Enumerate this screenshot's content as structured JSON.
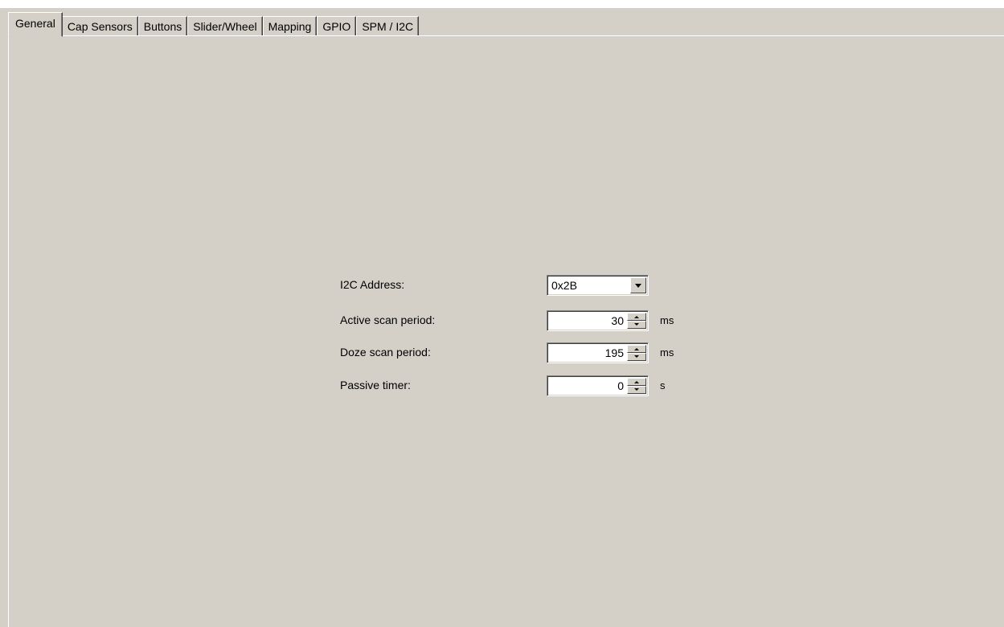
{
  "tabs": [
    {
      "label": "General",
      "active": true
    },
    {
      "label": "Cap Sensors",
      "active": false
    },
    {
      "label": "Buttons",
      "active": false
    },
    {
      "label": "Slider/Wheel",
      "active": false
    },
    {
      "label": "Mapping",
      "active": false
    },
    {
      "label": "GPIO",
      "active": false
    },
    {
      "label": "SPM / I2C",
      "active": false
    }
  ],
  "general": {
    "i2c_address": {
      "label": "I2C Address:",
      "value": "0x2B",
      "icon": "chevron-down-icon"
    },
    "active_scan_period": {
      "label": "Active scan period:",
      "value": "30",
      "unit": "ms"
    },
    "doze_scan_period": {
      "label": "Doze scan period:",
      "value": "195",
      "unit": "ms"
    },
    "passive_timer": {
      "label": "Passive timer:",
      "value": "0",
      "unit": "s"
    }
  },
  "colors": {
    "background": "#d4d0c8",
    "field": "#ffffff",
    "highlight": "#ffffff",
    "shadow": "#808080"
  }
}
